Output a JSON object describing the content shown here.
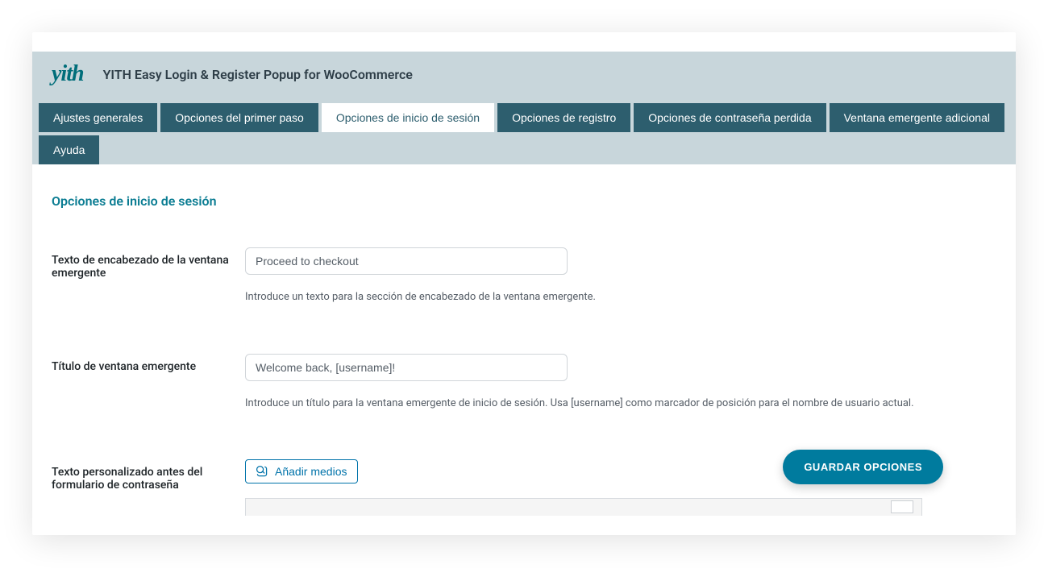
{
  "header": {
    "logo_text": "yith",
    "title": "YITH Easy Login & Register Popup for WooCommerce"
  },
  "tabs": [
    {
      "label": "Ajustes generales",
      "active": false
    },
    {
      "label": "Opciones del primer paso",
      "active": false
    },
    {
      "label": "Opciones de inicio de sesión",
      "active": true
    },
    {
      "label": "Opciones de registro",
      "active": false
    },
    {
      "label": "Opciones de contraseña perdida",
      "active": false
    },
    {
      "label": "Ventana emergente adicional",
      "active": false
    },
    {
      "label": "Ayuda",
      "active": false
    }
  ],
  "section": {
    "title": "Opciones de inicio de sesión"
  },
  "fields": {
    "header_text": {
      "label": "Texto de encabezado de la ventana emergente",
      "value": "Proceed to checkout",
      "help": "Introduce un texto para la sección de encabezado de la ventana emergente."
    },
    "popup_title": {
      "label": "Título de ventana emergente",
      "value": "Welcome back, [username]!",
      "help": "Introduce un título para la ventana emergente de inicio de sesión. Usa [username] como marcador de posición para el nombre de usuario actual."
    },
    "custom_text": {
      "label": "Texto personalizado antes del formulario de contraseña",
      "add_media_label": "Añadir medios"
    }
  },
  "save_button": {
    "label": "GUARDAR OPCIONES"
  }
}
